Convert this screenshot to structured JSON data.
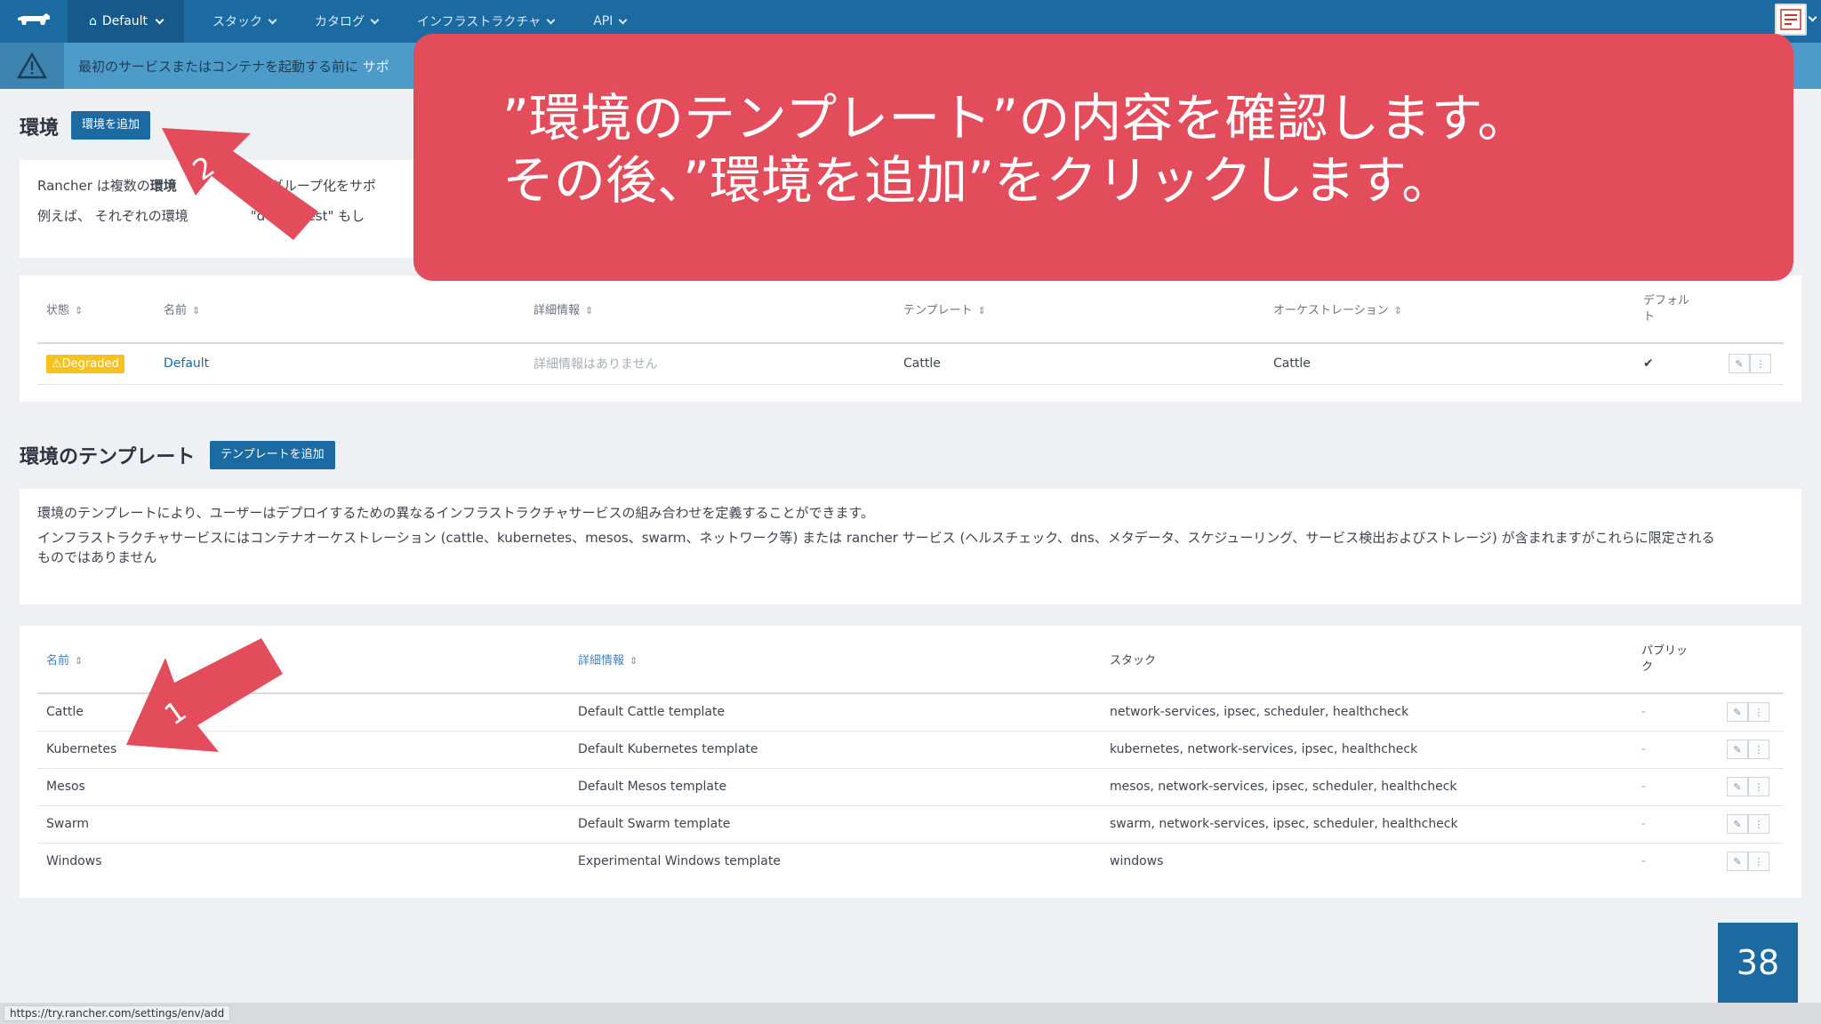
{
  "nav": {
    "env_label": "Default",
    "items": [
      {
        "label": "スタック"
      },
      {
        "label": "カタログ"
      },
      {
        "label": "インフラストラクチャ"
      },
      {
        "label": "API"
      }
    ]
  },
  "banner": {
    "text": "最初のサービスまたはコンテナを起動する前に",
    "link": "サポ"
  },
  "env_section": {
    "title": "環境",
    "add_button": "環境を追加",
    "info_line1_a": "Rancher は複数の",
    "info_line1_b": "環境",
    "info_line1_c": "のグループ化をサポ",
    "info_line2_a": "例えば、 それぞれの環境",
    "info_line2_b": "\"dev\", \"test\" もし"
  },
  "env_table": {
    "headers": {
      "status": "状態",
      "name": "名前",
      "description": "詳細情報",
      "template": "テンプレート",
      "orchestration": "オーケストレーション",
      "default_l1": "デフォル",
      "default_l2": "ト"
    },
    "row": {
      "status": "Degraded",
      "name": "Default",
      "description": "詳細情報はありません",
      "template": "Cattle",
      "orchestration": "Cattle",
      "default": "✔"
    }
  },
  "tpl_section": {
    "title": "環境のテンプレート",
    "add_button": "テンプレートを追加",
    "info_line1": "環境のテンプレートにより、ユーザーはデプロイするための異なるインフラストラクチャサービスの組み合わせを定義することができます。",
    "info_line2": "インフラストラクチャサービスにはコンテナオーケストレーション (cattle、kubernetes、mesos、swarm、ネットワーク等) または rancher サービス (ヘルスチェック、dns、メタデータ、スケジューリング、サービス検出およびストレージ) が含まれますがこれらに限定される",
    "info_line3": "ものではありません"
  },
  "tpl_table": {
    "headers": {
      "name": "名前",
      "description": "詳細情報",
      "stack": "スタック",
      "public_l1": "パブリッ",
      "public_l2": "ク"
    },
    "rows": [
      {
        "name": "Cattle",
        "description": "Default Cattle template",
        "stack": "network-services, ipsec, scheduler, healthcheck",
        "public": "-"
      },
      {
        "name": "Kubernetes",
        "description": "Default Kubernetes template",
        "stack": "kubernetes, network-services, ipsec, healthcheck",
        "public": "-"
      },
      {
        "name": "Mesos",
        "description": "Default Mesos template",
        "stack": "mesos, network-services, ipsec, scheduler, healthcheck",
        "public": "-"
      },
      {
        "name": "Swarm",
        "description": "Default Swarm template",
        "stack": "swarm, network-services, ipsec, scheduler, healthcheck",
        "public": "-"
      },
      {
        "name": "Windows",
        "description": "Experimental Windows template",
        "stack": "windows",
        "public": "-"
      }
    ]
  },
  "callout": {
    "line1": "”環境のテンプレート”の内容を確認します。",
    "line2": "その後、”環境を追加”をクリックします。"
  },
  "arrows": {
    "arrow1_label": "1",
    "arrow2_label": "2"
  },
  "page_number": "38",
  "status_url": "https://try.rancher.com/settings/env/add",
  "colors": {
    "nav": "#1b6ba2",
    "callout": "#e34c5b",
    "badge": "#f7c21e"
  }
}
